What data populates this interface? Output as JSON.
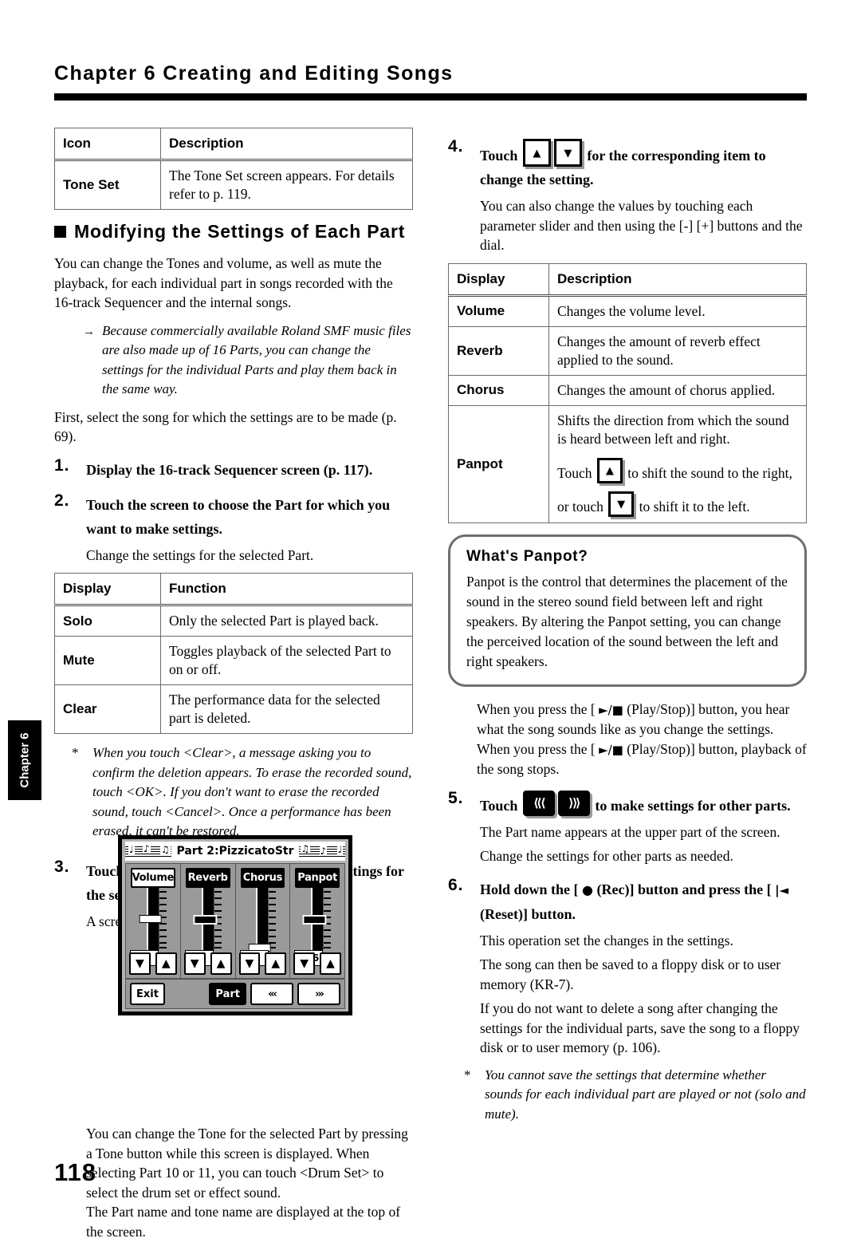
{
  "header": {
    "chapter_title": "Chapter 6 Creating and Editing Songs"
  },
  "side_tab": {
    "label": "Chapter 6"
  },
  "page_number": "118",
  "left_column": {
    "icon_table": {
      "headers": [
        "Icon",
        "Description"
      ],
      "rows": [
        {
          "icon": "Tone Set",
          "description": "The Tone Set screen appears. For details refer to p. 119."
        }
      ]
    },
    "section_heading": "Modifying the Settings of Each Part",
    "intro_paragraph": "You can change the Tones and volume, as well as mute the playback, for each individual part in songs recorded with the 16-track Sequencer and the internal songs.",
    "arrow_note": "Because commercially available Roland SMF music files are also made up of 16 Parts, you can change the settings for the individual Parts and play them back in the same way.",
    "first_select": "First, select the song for which the settings are to be made (p. 69).",
    "step1": {
      "num": "1.",
      "text": "Display the 16-track Sequencer screen (p. 117)."
    },
    "step2": {
      "num": "2.",
      "text": "Touch the screen to choose the Part for which you want to make settings.",
      "body": "Change the settings for the selected Part."
    },
    "function_table": {
      "headers": [
        "Display",
        "Function"
      ],
      "rows": [
        {
          "display": "Solo",
          "function": "Only the selected Part is played back."
        },
        {
          "display": "Mute",
          "function": "Toggles playback of the selected Part to on or off."
        },
        {
          "display": "Clear",
          "function": "The performance data for the selected part is deleted."
        }
      ]
    },
    "clear_note": "When you touch <Clear>, a message asking you to confirm the deletion appears. To erase the recorded sound, touch <OK>. If you don't want to erase the recorded sound, touch <Cancel>. Once a performance has been erased, it can't be restored.",
    "step3": {
      "num": "3.",
      "text": "Touch <Options> to make more detailed settings for the selected part.",
      "body": "A screen like the one shown below appears."
    },
    "closing_paragraph_1": "You can change the Tone for the selected Part by pressing a Tone button while this screen is displayed. When selecting Part 10 or 11, you can touch <Drum Set> to select the drum set or effect sound.",
    "closing_paragraph_2": "The Part name and tone name are displayed at the top of the screen."
  },
  "lcd_screen": {
    "title": "Part 2:PizzicatoStr",
    "channels": [
      {
        "label": "Volume",
        "selected": false,
        "value": "80",
        "thumb_pct": 47
      },
      {
        "label": "Reverb",
        "selected": true,
        "value": "80",
        "thumb_pct": 47
      },
      {
        "label": "Chorus",
        "selected": true,
        "value": "0",
        "thumb_pct": 92
      },
      {
        "label": "Panpot",
        "selected": true,
        "value": "R16",
        "thumb_pct": 47
      }
    ],
    "down_arrow_glyph": "▼",
    "up_arrow_glyph": "▲",
    "exit_label": "Exit",
    "part_label": "Part",
    "prev_glyph": "«‹",
    "next_glyph": "›»"
  },
  "right_column": {
    "step4": {
      "num": "4.",
      "text_before": "Touch",
      "text_after": "for the corresponding item to change the setting.",
      "body": "You can also change the values by touching each parameter slider and then using the [-] [+] buttons and the dial."
    },
    "display_table": {
      "headers": [
        "Display",
        "Description"
      ],
      "rows": [
        {
          "display": "Volume",
          "description": "Changes the volume level."
        },
        {
          "display": "Reverb",
          "description": "Changes the amount of reverb effect applied to the sound."
        },
        {
          "display": "Chorus",
          "description": "Changes the amount of chorus applied."
        },
        {
          "display": "Panpot",
          "description_line1": "Shifts the direction from which the sound is heard between left and right.",
          "touch_label": "Touch",
          "touch_right_text": "to shift the sound to the right,",
          "or_touch_label": "or touch",
          "touch_left_text": "to shift it to the left."
        }
      ]
    },
    "callout": {
      "title": "What's Panpot?",
      "body": "Panpot is the control that determines the placement of the sound in the stereo sound field between left and right speakers. By altering the Panpot setting, you can change the perceived location of the sound between the left and right speakers."
    },
    "play_stop_paragraph_1": "When you press the [ ",
    "play_stop_glyph": "►/■",
    "play_stop_paragraph_2": " (Play/Stop)] button, you hear what the song sounds like as you change the settings. When you press the [ ",
    "play_stop_paragraph_3": " (Play/Stop)] button, playback of the song stops.",
    "step5": {
      "num": "5.",
      "text_before": "Touch",
      "text_after": "to make settings for other parts.",
      "body1": "The Part name appears at the upper part of the screen.",
      "body2": "Change the settings for other parts as needed."
    },
    "step6": {
      "num": "6.",
      "text_a": "Hold down the [ ",
      "rec_glyph": "●",
      "text_b": " (Rec)] button and press the [ ",
      "reset_glyph": "|◄",
      "text_c": " (Reset)] button.",
      "body1": "This operation set the changes in the settings.",
      "body2": "The song can then be saved to a floppy disk or to user memory (KR-7).",
      "body3": "If you do not want to delete a song after changing the settings for the individual parts, save the song to a floppy disk or to user memory (p. 106)."
    },
    "final_note": "You cannot save the settings that determine whether sounds for each individual part are played or not (solo and mute)."
  }
}
